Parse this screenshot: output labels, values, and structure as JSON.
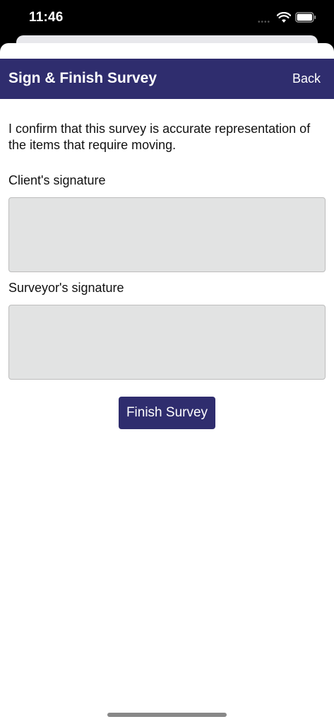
{
  "status": {
    "time": "11:46"
  },
  "nav": {
    "title": "Sign & Finish Survey",
    "back_label": "Back"
  },
  "form": {
    "confirm_text": "I confirm that this survey is accurate representation of the items that require moving.",
    "client_label": "Client's signature",
    "surveyor_label": "Surveyor's signature",
    "finish_label": "Finish Survey"
  },
  "colors": {
    "brand": "#2f2d6e",
    "signature_bg": "#e2e3e3"
  }
}
